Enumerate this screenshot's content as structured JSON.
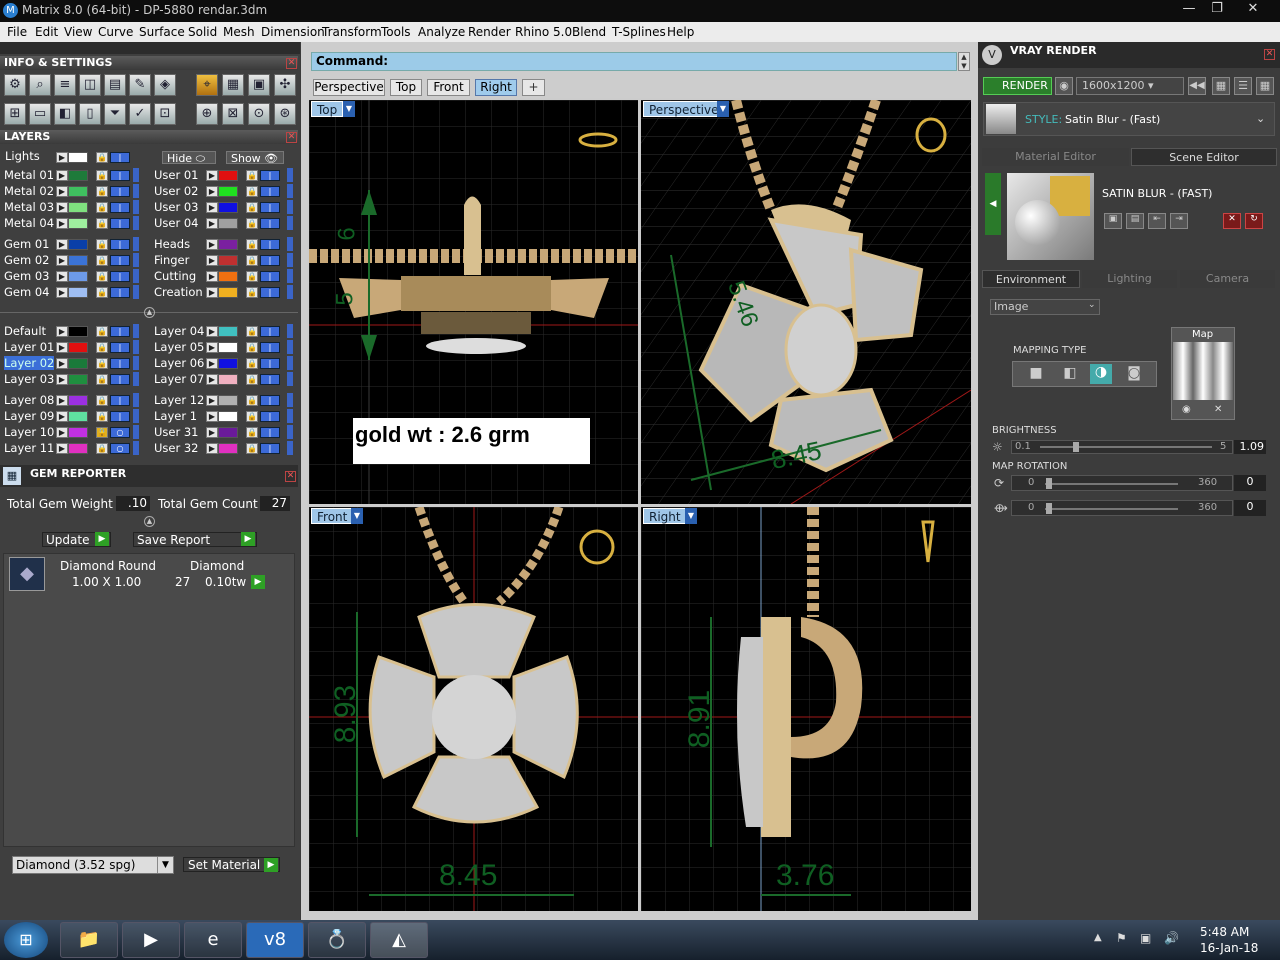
{
  "window": {
    "title": "Matrix 8.0 (64-bit) - DP-5880 rendar.3dm",
    "logo_icon": "matrix-logo-icon",
    "controls": [
      "—",
      "❐",
      "✕"
    ]
  },
  "menu": [
    "File",
    "Edit",
    "View",
    "Curve",
    "Surface",
    "Solid",
    "Mesh",
    "Dimension",
    "Transform",
    "Tools",
    "Analyze",
    "Render",
    "Rhino 5.0",
    "Blend",
    "T-Splines",
    "Help"
  ],
  "info_settings": {
    "title": "INFO & SETTINGS"
  },
  "layers": {
    "title": "LAYERS",
    "lights_label": "Lights",
    "hide_label": "Hide",
    "show_label": "Show",
    "left": [
      {
        "name": "Metal 01",
        "color": "#1e7a3a"
      },
      {
        "name": "Metal 02",
        "color": "#3fbf5f"
      },
      {
        "name": "Metal 03",
        "color": "#7fe07f"
      },
      {
        "name": "Metal 04",
        "color": "#9fef9f"
      },
      {
        "name": "Gem 01",
        "color": "#0a3fa8"
      },
      {
        "name": "Gem 02",
        "color": "#3b73d6"
      },
      {
        "name": "Gem 03",
        "color": "#6d9ae8"
      },
      {
        "name": "Gem 04",
        "color": "#9fbef2"
      },
      {
        "name": "Default",
        "color": "#000000"
      },
      {
        "name": "Layer 01",
        "color": "#e01010"
      },
      {
        "name": "Layer 02",
        "color": "#1a7a3a"
      },
      {
        "name": "Layer 03",
        "color": "#1f8f3f"
      },
      {
        "name": "Layer 08",
        "color": "#9b30e0"
      },
      {
        "name": "Layer 09",
        "color": "#5fe0a0"
      },
      {
        "name": "Layer 10",
        "color": "#c030e0"
      },
      {
        "name": "Layer 11",
        "color": "#e030c0"
      }
    ],
    "right": [
      {
        "name": "User 01",
        "color": "#e01010"
      },
      {
        "name": "User 02",
        "color": "#20e020"
      },
      {
        "name": "User 03",
        "color": "#1010e0"
      },
      {
        "name": "User 04",
        "color": "#a0a0a0"
      },
      {
        "name": "Heads",
        "color": "#7a20a0"
      },
      {
        "name": "Finger",
        "color": "#c03030"
      },
      {
        "name": "Cutting",
        "color": "#f07010"
      },
      {
        "name": "Creation",
        "color": "#f0b020"
      },
      {
        "name": "Layer 04",
        "color": "#40c0c0"
      },
      {
        "name": "Layer 05",
        "color": "#ffffff"
      },
      {
        "name": "Layer 06",
        "color": "#1010e0"
      },
      {
        "name": "Layer 07",
        "color": "#f0b0c0"
      },
      {
        "name": "Layer 12",
        "color": "#b0b0b0"
      },
      {
        "name": "Layer 1",
        "color": "#ffffff"
      },
      {
        "name": "User 31",
        "color": "#6a1a9a"
      },
      {
        "name": "User 32",
        "color": "#e030c0"
      }
    ]
  },
  "gem_reporter": {
    "title": "GEM REPORTER",
    "total_weight_label": "Total Gem Weight",
    "total_weight": ".10",
    "total_count_label": "Total Gem Count",
    "total_count": "27",
    "update_label": "Update",
    "save_label": "Save Report",
    "row": {
      "col1_header": "Diamond Round",
      "col2_header": "Diamond",
      "size": "1.00 X 1.00",
      "count": "27",
      "weight": "0.10tw"
    },
    "material_select": "Diamond    (3.52 spg)",
    "set_material_label": "Set Material"
  },
  "command": {
    "label": "Command:"
  },
  "view_tabs": [
    "Perspective",
    "Top",
    "Front",
    "Right",
    "+"
  ],
  "viewports": {
    "top": {
      "label": "Top",
      "annotation": "gold wt : 2.6 grm",
      "dims": [
        "6",
        "5"
      ]
    },
    "perspective": {
      "label": "Perspective",
      "dims": [
        "5.46",
        "8.45"
      ]
    },
    "front": {
      "label": "Front",
      "dims": [
        "8.93",
        "8.45"
      ]
    },
    "right": {
      "label": "Right",
      "dims": [
        "8.91",
        "3.76"
      ]
    }
  },
  "vray": {
    "title": "VRAY RENDER",
    "render_label": "RENDER",
    "resolution": "1600x1200",
    "style_label": "STYLE:",
    "style_value": "Satin Blur - (Fast)",
    "tabs": [
      "Material Editor",
      "Scene Editor"
    ],
    "preset_name": "SATIN BLUR - (FAST)",
    "env_tabs": [
      "Environment",
      "Lighting",
      "Camera"
    ],
    "env_select": "Image",
    "mapping_type_label": "MAPPING TYPE",
    "map_label": "Map",
    "brightness_label": "BRIGHTNESS",
    "brightness_min": "0.1",
    "brightness_max": "5",
    "brightness_value": "1.09",
    "brightness_level": 0.2,
    "rotation_label": "MAP ROTATION",
    "rot1": {
      "min": "0",
      "max": "360",
      "value": "0"
    },
    "rot2": {
      "min": "0",
      "max": "360",
      "value": "0"
    }
  },
  "taskbar": {
    "time": "5:48 AM",
    "date": "16-Jan-18"
  }
}
